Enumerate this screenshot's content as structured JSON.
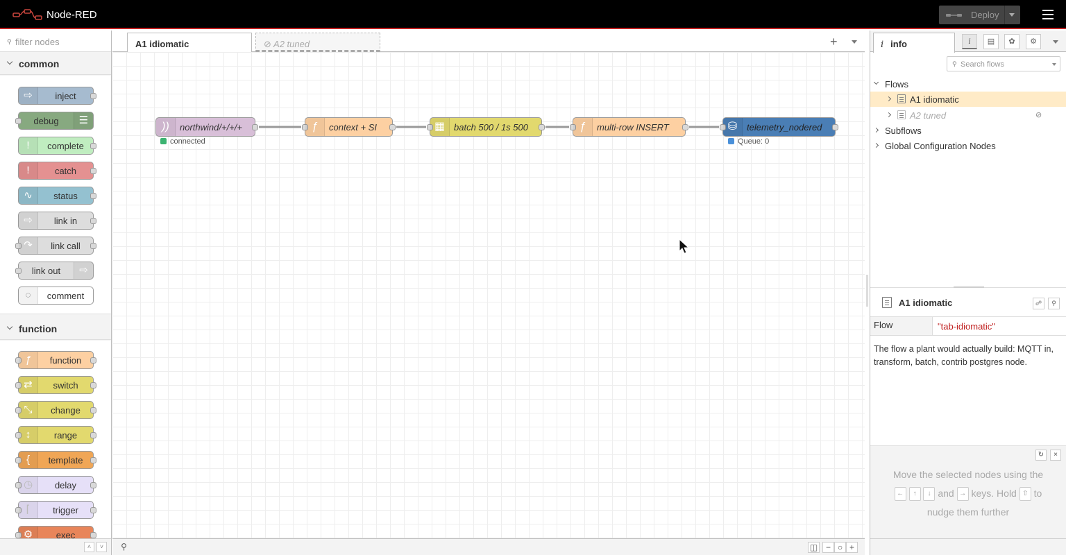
{
  "header": {
    "title": "Node-RED",
    "deploy_label": "Deploy"
  },
  "palette": {
    "search_placeholder": "filter nodes",
    "categories": [
      {
        "label": "common",
        "nodes": [
          "inject",
          "debug",
          "complete",
          "catch",
          "status",
          "link in",
          "link call",
          "link out",
          "comment"
        ]
      },
      {
        "label": "function",
        "nodes": [
          "function",
          "switch",
          "change",
          "range",
          "template",
          "delay",
          "trigger",
          "exec"
        ]
      }
    ]
  },
  "workspace": {
    "tabs": [
      {
        "label": "A1 idiomatic",
        "active": true
      },
      {
        "label": "A2 tuned",
        "disabled": true,
        "disabled_glyph": "⊘"
      }
    ],
    "flow_nodes": [
      {
        "label": "northwind/+/+/+",
        "type": "mqtt in",
        "color": "#d8bfd8",
        "status": {
          "text": "connected",
          "color": "#3cb371"
        }
      },
      {
        "label": "context + SI",
        "type": "function",
        "color": "#fdd0a2"
      },
      {
        "label": "batch 500 / 1s 500",
        "type": "batch",
        "color": "#e2d96e"
      },
      {
        "label": "multi-row INSERT",
        "type": "function",
        "color": "#fdd0a2"
      },
      {
        "label": "telemetry_nodered",
        "type": "postgres",
        "color": "#4a7eb5",
        "status": {
          "text": "Queue: 0",
          "color": "#4a90d9"
        }
      }
    ]
  },
  "sidebar": {
    "tab_label": "info",
    "search_placeholder": "Search flows",
    "tree": {
      "flows_label": "Flows",
      "flows": [
        {
          "label": "A1 idiomatic",
          "selected": true
        },
        {
          "label": "A2 tuned",
          "disabled": true,
          "disabled_glyph": "⊘"
        }
      ],
      "subflows_label": "Subflows",
      "global_config_label": "Global Configuration Nodes"
    },
    "info": {
      "title": "A1 idiomatic",
      "prop_key": "Flow",
      "prop_value": "\"tab-idiomatic\"",
      "description": "The flow a plant would actually build: MQTT in, transform, batch, contrib postgres node."
    },
    "tip": {
      "line1": "Move the selected nodes using the",
      "and": "and",
      "keys_hold": "keys. Hold",
      "to": "to",
      "line3": "nudge them further",
      "key_left": "←",
      "key_up": "↑",
      "key_down": "↓",
      "key_right": "→",
      "key_shift": "⇧"
    }
  }
}
